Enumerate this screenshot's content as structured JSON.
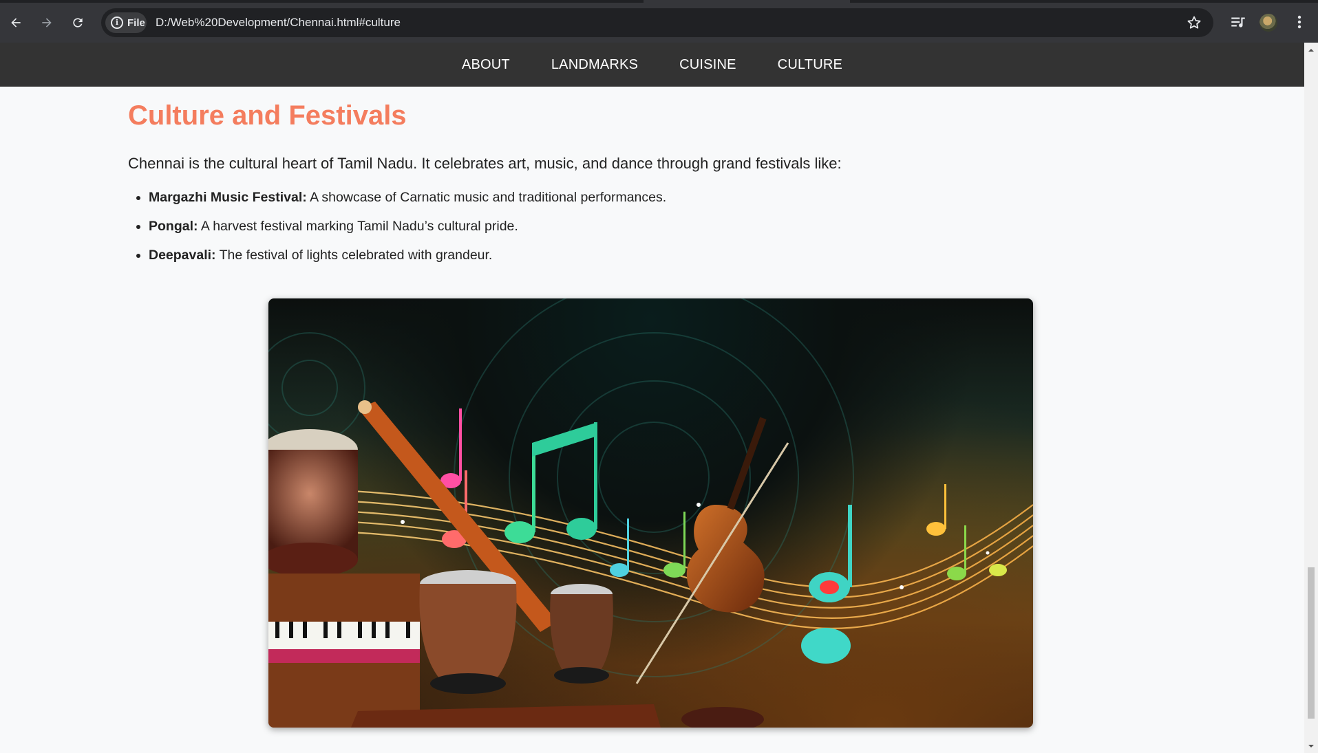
{
  "browser": {
    "file_chip_label": "File",
    "url": "D:/Web%20Development/Chennai.html#culture",
    "icons": [
      "back-arrow-icon",
      "forward-arrow-icon",
      "reload-icon",
      "info-icon",
      "bookmark-star-icon",
      "media-queue-icon",
      "profile-avatar",
      "menu-kebab-icon"
    ]
  },
  "nav": {
    "items": [
      {
        "label": "ABOUT"
      },
      {
        "label": "LANDMARKS"
      },
      {
        "label": "CUISINE"
      },
      {
        "label": "CULTURE"
      }
    ]
  },
  "culture": {
    "title": "Culture and Festivals",
    "intro": "Chennai is the cultural heart of Tamil Nadu. It celebrates art, music, and dance through grand festivals like:",
    "festivals": [
      {
        "name": "Margazhi Music Festival:",
        "desc": " A showcase of Carnatic music and traditional performances."
      },
      {
        "name": "Pongal:",
        "desc": " A harvest festival marking Tamil Nadu’s cultural pride."
      },
      {
        "name": "Deepavali:",
        "desc": " The festival of lights celebrated with grandeur."
      }
    ],
    "image_subject": "Indian classical musical instruments with colorful music notes"
  },
  "colors": {
    "title": "#f47d5e",
    "nav_bg": "#333333",
    "page_bg": "#f8f9fa",
    "chrome_bg": "#35363a"
  }
}
